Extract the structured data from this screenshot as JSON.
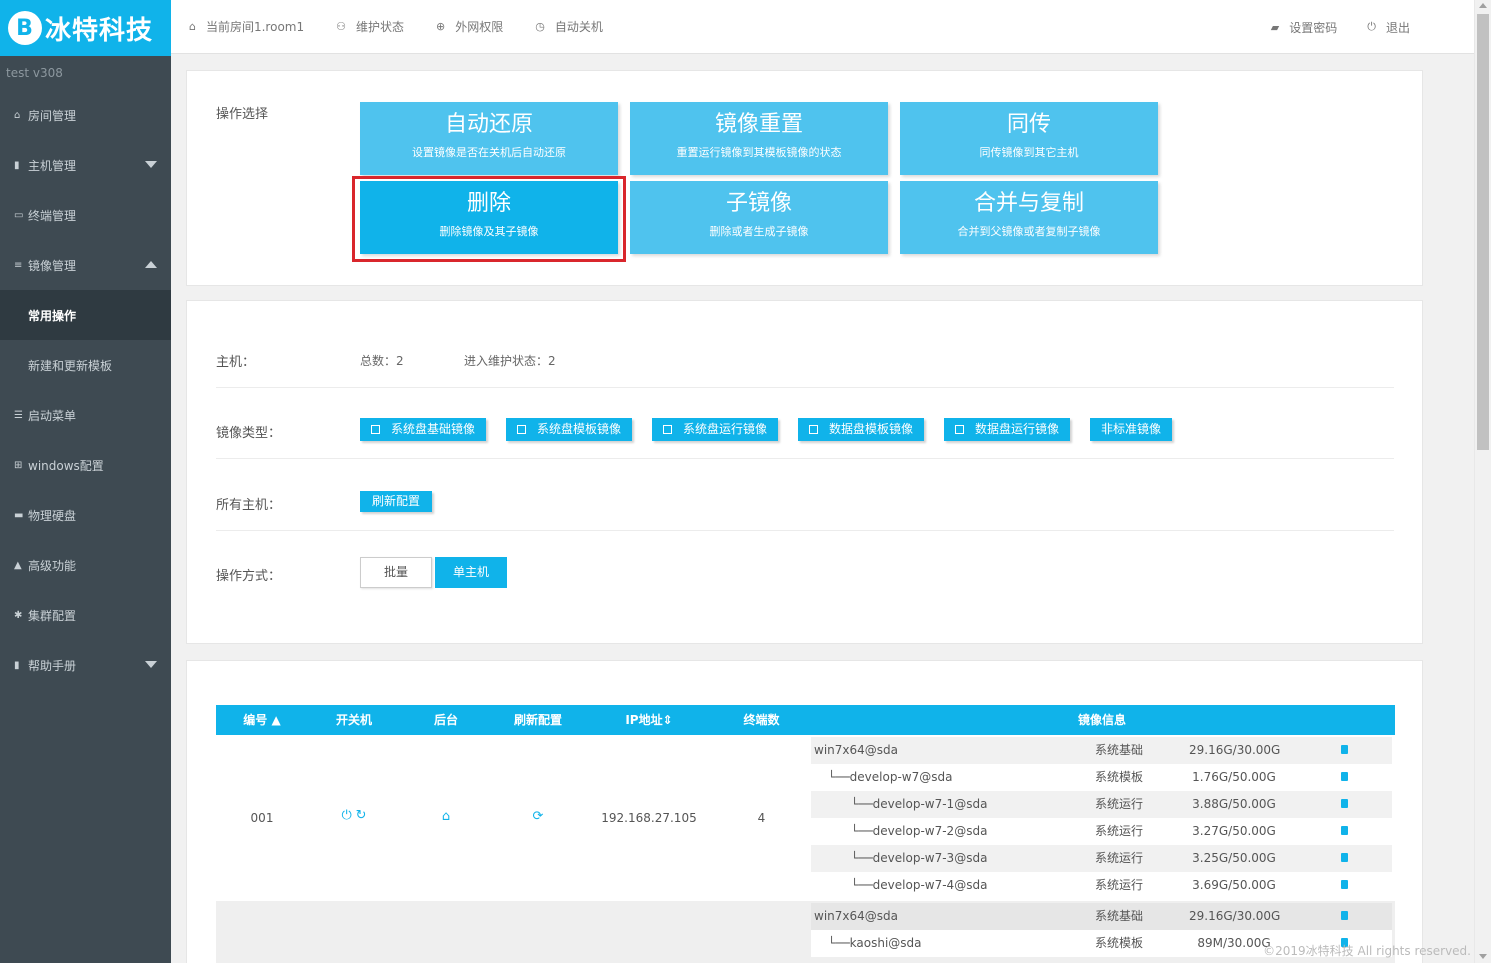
{
  "brand": {
    "logo_mark": "B",
    "name": "冰特科技"
  },
  "sidebar": {
    "version": "test  v308",
    "items": [
      {
        "label": "房间管理",
        "icon": "home-icon",
        "glyph": "⌂"
      },
      {
        "label": "主机管理",
        "icon": "server-icon",
        "glyph": "▮"
      },
      {
        "label": "终端管理",
        "icon": "monitor-icon",
        "glyph": "▭"
      },
      {
        "label": "镜像管理",
        "icon": "database-icon",
        "glyph": "≡"
      },
      {
        "label": "常用操作"
      },
      {
        "label": "新建和更新模板"
      },
      {
        "label": "启动菜单",
        "icon": "list-icon",
        "glyph": "☰"
      },
      {
        "label": "windows配置",
        "icon": "windows-icon",
        "glyph": "⊞"
      },
      {
        "label": "物理硬盘",
        "icon": "hdd-icon",
        "glyph": "▬"
      },
      {
        "label": "高级功能",
        "icon": "warning-icon",
        "glyph": "▲"
      },
      {
        "label": "集群配置",
        "icon": "gear-icon",
        "glyph": "✱"
      },
      {
        "label": "帮助手册",
        "icon": "book-icon",
        "glyph": "▮"
      }
    ]
  },
  "topbar": {
    "room": "当前房间1.room1",
    "maintain": "维护状态",
    "network": "外网权限",
    "shutdown": "自动关机",
    "set_password": "设置密码",
    "logout": "退出"
  },
  "operations": {
    "label": "操作选择",
    "cards": [
      {
        "title": "自动还原",
        "sub": "设置镜像是否在关机后自动还原"
      },
      {
        "title": "镜像重置",
        "sub": "重置运行镜像到其模板镜像的状态"
      },
      {
        "title": "同传",
        "sub": "同传镜像到其它主机"
      },
      {
        "title": "删除",
        "sub": "删除镜像及其子镜像"
      },
      {
        "title": "子镜像",
        "sub": "删除或者生成子镜像"
      },
      {
        "title": "合并与复制",
        "sub": "合并到父镜像或者复制子镜像"
      }
    ]
  },
  "filters": {
    "host_label": "主机：",
    "total": "总数：2",
    "maintenance": "进入维护状态：2",
    "image_type_label": "镜像类型：",
    "image_types": [
      "系统盘基础镜像",
      "系统盘模板镜像",
      "系统盘运行镜像",
      "数据盘模板镜像",
      "数据盘运行镜像",
      "非标准镜像"
    ],
    "all_hosts_label": "所有主机：",
    "refresh_button": "刷新配置",
    "mode_label": "操作方式：",
    "mode_batch": "批量",
    "mode_single": "单主机"
  },
  "table": {
    "headers": [
      "编号",
      "开关机",
      "后台",
      "刷新配置",
      "IP地址",
      "终端数",
      "镜像信息"
    ],
    "hosts": [
      {
        "id": "001",
        "ip": "192.168.27.105",
        "terminals": "4",
        "images": [
          {
            "name": "win7x64@sda",
            "type": "系统基础",
            "size": "29.16G/30.00G"
          },
          {
            "name": "└──develop-w7@sda",
            "type": "系统模板",
            "size": "1.76G/50.00G"
          },
          {
            "name": "└──develop-w7-1@sda",
            "type": "系统运行",
            "size": "3.88G/50.00G"
          },
          {
            "name": "└──develop-w7-2@sda",
            "type": "系统运行",
            "size": "3.27G/50.00G"
          },
          {
            "name": "└──develop-w7-3@sda",
            "type": "系统运行",
            "size": "3.25G/50.00G"
          },
          {
            "name": "└──develop-w7-4@sda",
            "type": "系统运行",
            "size": "3.69G/50.00G"
          }
        ]
      },
      {
        "images": [
          {
            "name": "win7x64@sda",
            "type": "系统基础",
            "size": "29.16G/30.00G"
          },
          {
            "name": "└──kaoshi@sda",
            "type": "系统模板",
            "size": "89M/30.00G"
          }
        ]
      }
    ]
  },
  "footer": "©2019冰特科技 All rights reserved.",
  "colors": {
    "accent": "#10b3ea",
    "card": "#4fc3ee",
    "sidebar": "#3e4a52",
    "highlight": "#d9262c"
  }
}
